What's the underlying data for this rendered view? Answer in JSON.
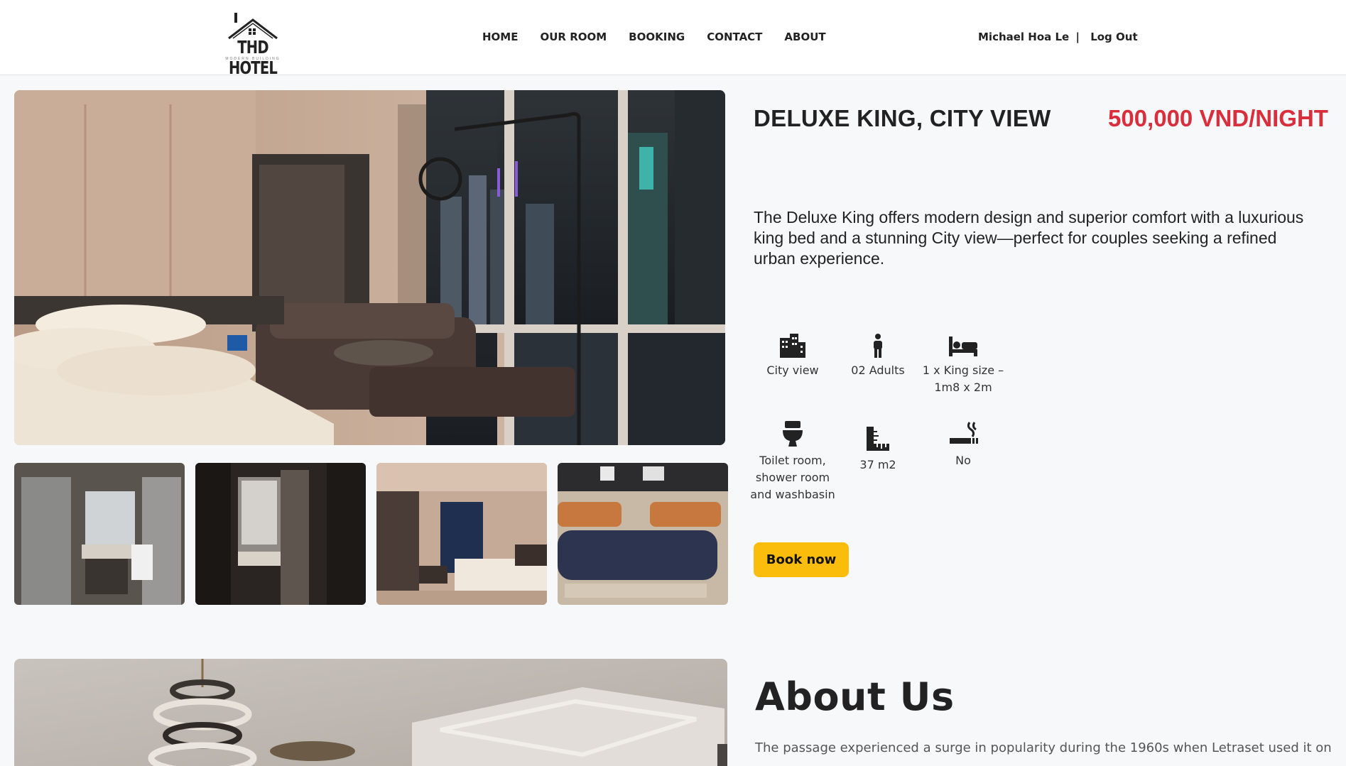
{
  "header": {
    "logo_text": "THD HOTEL",
    "logo_subtext": "MODERN BUILDING",
    "nav": [
      "HOME",
      "OUR ROOM",
      "BOOKING",
      "CONTACT",
      "ABOUT"
    ],
    "user_name": "Michael Hoa Le",
    "separator": "|",
    "logout_label": "Log Out"
  },
  "room": {
    "title": "DELUXE KING, CITY VIEW",
    "price": "500,000 VND/NIGHT",
    "description": "The Deluxe King offers modern design and superior comfort with a luxurious king bed and a stunning City view—perfect for couples seeking a refined urban experience.",
    "amenities": [
      {
        "icon": "building-icon",
        "label": "City view"
      },
      {
        "icon": "person-icon",
        "label": "02 Adults"
      },
      {
        "icon": "bed-icon",
        "label": "1 x King size – 1m8 x 2m"
      },
      {
        "icon": "toilet-icon",
        "label": "Toilet room, shower room and washbasin"
      },
      {
        "icon": "ruler-icon",
        "label": "37 m2"
      },
      {
        "icon": "smoking-icon",
        "label": "No"
      }
    ],
    "book_label": "Book now"
  },
  "about": {
    "title": "About Us",
    "text": "The passage experienced a surge in popularity during the 1960s when Letraset used it on"
  },
  "colors": {
    "price": "#d92f3d",
    "button": "#fbbd0b",
    "background": "#f7f8fa"
  }
}
